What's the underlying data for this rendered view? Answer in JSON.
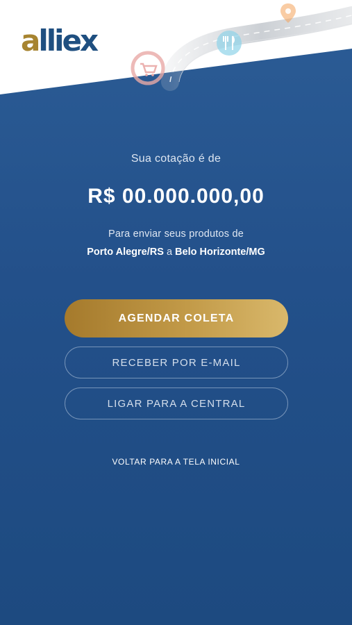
{
  "brand": {
    "logo_text_a": "a",
    "logo_text_rest": "lliex"
  },
  "quote": {
    "intro": "Sua cotação é de",
    "price": "R$ 00.000.000,00",
    "send_line": "Para enviar seus produtos de",
    "origin": "Porto Alegre/RS",
    "connector": "a",
    "destination": "Belo Horizonte/MG"
  },
  "actions": {
    "schedule": "AGENDAR COLETA",
    "email": "RECEBER POR E-MAIL",
    "call": "LIGAR PARA A CENTRAL",
    "back": "VOLTAR PARA A TELA INICIAL"
  },
  "colors": {
    "background": "#23508a",
    "gold": "#c29a48",
    "logo_blue": "#1f4f80"
  },
  "icons": [
    "location-pin-icon",
    "shopping-cart-icon",
    "restaurant-icon",
    "road-illustration"
  ]
}
